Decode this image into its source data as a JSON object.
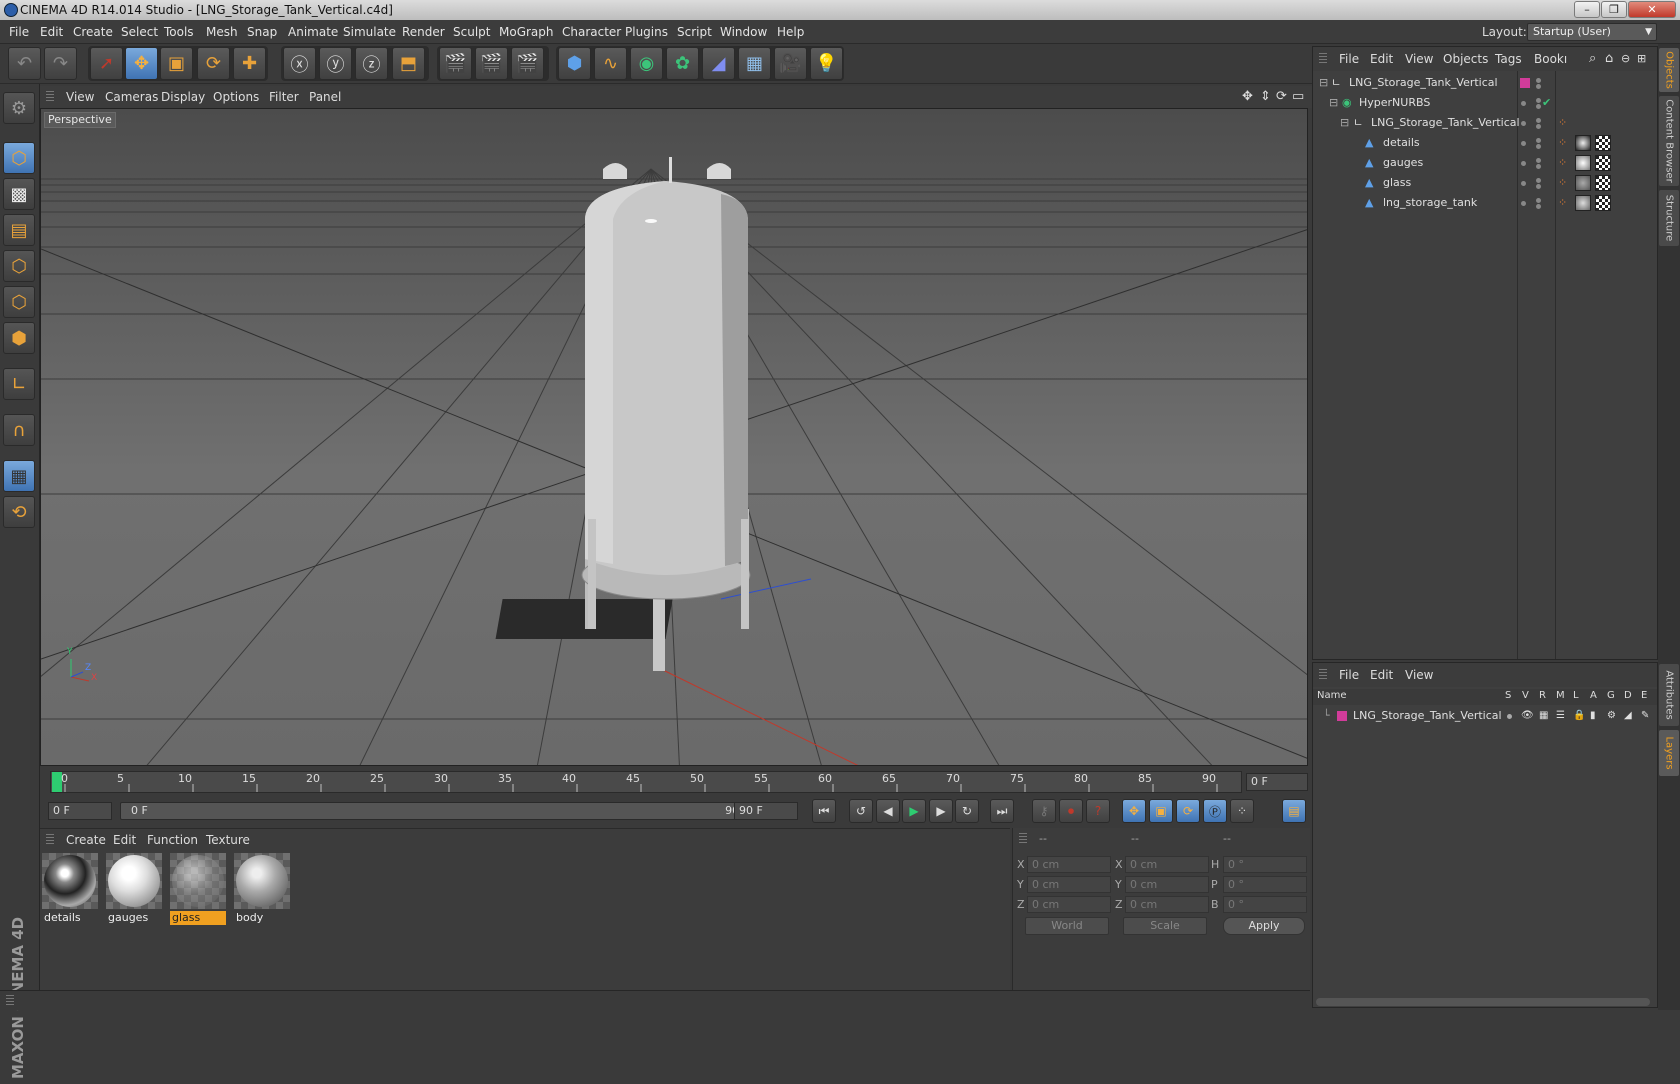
{
  "window": {
    "title": "CINEMA 4D R14.014 Studio - [LNG_Storage_Tank_Vertical.c4d]",
    "buttons": [
      "–",
      "❐",
      "✕"
    ]
  },
  "menu": [
    "File",
    "Edit",
    "Create",
    "Select",
    "Tools",
    "Mesh",
    "Snap",
    "Animate",
    "Simulate",
    "Render",
    "Sculpt",
    "MoGraph",
    "Character",
    "Plugins",
    "Script",
    "Window",
    "Help"
  ],
  "layout": {
    "label": "Layout:",
    "value": "Startup (User)"
  },
  "viewport": {
    "menu": [
      "View",
      "Cameras",
      "Display",
      "Options",
      "Filter",
      "Panel"
    ],
    "label": "Perspective",
    "axis": {
      "x": "X",
      "y": "Y",
      "z": "Z"
    }
  },
  "timeline": {
    "ticks": [
      "0",
      "5",
      "10",
      "15",
      "20",
      "25",
      "30",
      "35",
      "40",
      "45",
      "50",
      "55",
      "60",
      "65",
      "70",
      "75",
      "80",
      "85",
      "90"
    ],
    "current_frame": "0 F",
    "start_field": "0 F",
    "range_start": "0 F",
    "range_end": "90 F",
    "end_field": "90 F"
  },
  "materials": {
    "menu": [
      "Create",
      "Edit",
      "Function",
      "Texture"
    ],
    "items": [
      {
        "name": "details",
        "selected": false
      },
      {
        "name": "gauges",
        "selected": false
      },
      {
        "name": "glass",
        "selected": true
      },
      {
        "name": "body",
        "selected": false
      }
    ]
  },
  "coordinates": {
    "header": [
      "--",
      "--",
      "--"
    ],
    "rows": [
      {
        "l1": "X",
        "v1": "0 cm",
        "l2": "X",
        "v2": "0 cm",
        "l3": "H",
        "v3": "0 °"
      },
      {
        "l1": "Y",
        "v1": "0 cm",
        "l2": "Y",
        "v2": "0 cm",
        "l3": "P",
        "v3": "0 °"
      },
      {
        "l1": "Z",
        "v1": "0 cm",
        "l2": "Z",
        "v2": "0 cm",
        "l3": "B",
        "v3": "0 °"
      }
    ],
    "world": "World",
    "scale": "Scale",
    "apply": "Apply"
  },
  "objects": {
    "menu": [
      "File",
      "Edit",
      "View",
      "Objects",
      "Tags",
      "Bookı"
    ],
    "rows": [
      {
        "name": "LNG_Storage_Tank_Vertical",
        "indent": 0,
        "icon": "null-icon"
      },
      {
        "name": "HyperNURBS",
        "indent": 1,
        "icon": "hypernurbs-icon"
      },
      {
        "name": "LNG_Storage_Tank_Vertical",
        "indent": 2,
        "icon": "null-icon"
      },
      {
        "name": "details",
        "indent": 3,
        "icon": "polygon-icon"
      },
      {
        "name": "gauges",
        "indent": 3,
        "icon": "polygon-icon"
      },
      {
        "name": "glass",
        "indent": 3,
        "icon": "polygon-icon"
      },
      {
        "name": "lng_storage_tank",
        "indent": 3,
        "icon": "polygon-icon"
      }
    ]
  },
  "layers": {
    "menu": [
      "File",
      "Edit",
      "View"
    ],
    "columns": [
      "Name",
      "S",
      "V",
      "R",
      "M",
      "L",
      "A",
      "G",
      "D",
      "E"
    ],
    "rows": [
      {
        "name": "LNG_Storage_Tank_Vertical",
        "color": "#d23c9a"
      }
    ]
  },
  "side_tabs": [
    "Objects",
    "Content Browser",
    "Structure",
    "Attributes",
    "Layers"
  ],
  "brand": "MAXON CINEMA 4D",
  "colors": {
    "accent": "#f0a020",
    "layer": "#d23c9a",
    "active_tool": "#4f85c4"
  }
}
